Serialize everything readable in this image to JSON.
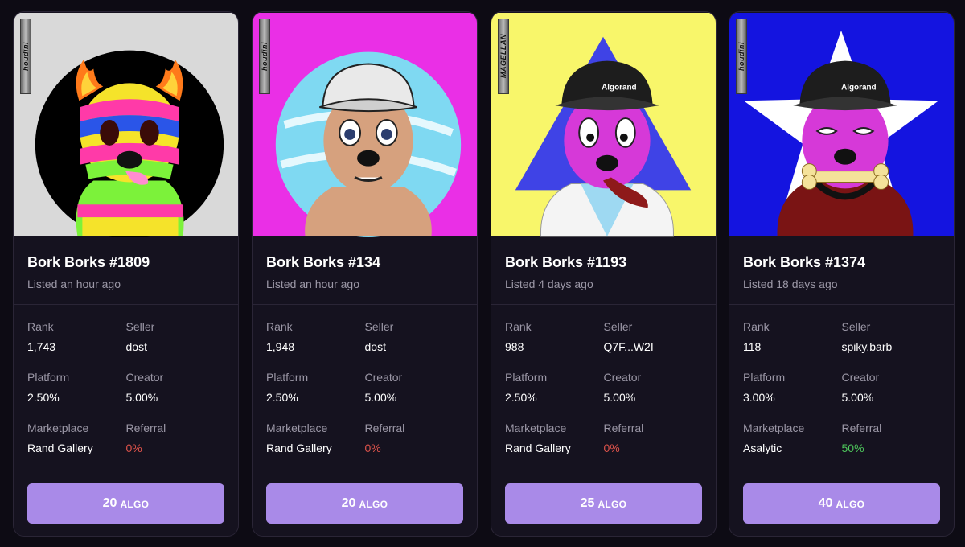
{
  "cards": [
    {
      "title": "Bork Borks #1809",
      "listed": "Listed an hour ago",
      "artist_sig": "houdini",
      "labels": {
        "rank": "Rank",
        "seller": "Seller",
        "platform": "Platform",
        "creator": "Creator",
        "marketplace": "Marketplace",
        "referral": "Referral"
      },
      "rank": "1,743",
      "seller": "dost",
      "platform": "2.50%",
      "creator": "5.00%",
      "marketplace": "Rand Gallery",
      "referral": "0%",
      "price": "20",
      "currency": "ALGO",
      "colors": {
        "background": "#d9d9d9",
        "accent": "#000000"
      }
    },
    {
      "title": "Bork Borks #134",
      "listed": "Listed an hour ago",
      "artist_sig": "houdini",
      "labels": {
        "rank": "Rank",
        "seller": "Seller",
        "platform": "Platform",
        "creator": "Creator",
        "marketplace": "Marketplace",
        "referral": "Referral"
      },
      "rank": "1,948",
      "seller": "dost",
      "platform": "2.50%",
      "creator": "5.00%",
      "marketplace": "Rand Gallery",
      "referral": "0%",
      "price": "20",
      "currency": "ALGO",
      "colors": {
        "background": "#ea2fe6",
        "accent": "#7fd9f2"
      }
    },
    {
      "title": "Bork Borks #1193",
      "listed": "Listed 4 days ago",
      "artist_sig": "MAGELLAN",
      "labels": {
        "rank": "Rank",
        "seller": "Seller",
        "platform": "Platform",
        "creator": "Creator",
        "marketplace": "Marketplace",
        "referral": "Referral"
      },
      "rank": "988",
      "seller": "Q7F...W2I",
      "platform": "2.50%",
      "creator": "5.00%",
      "marketplace": "Rand Gallery",
      "referral": "0%",
      "price": "25",
      "currency": "ALGO",
      "colors": {
        "background": "#f8f66a",
        "accent": "#3f43e6"
      }
    },
    {
      "title": "Bork Borks #1374",
      "listed": "Listed 18 days ago",
      "artist_sig": "houdini",
      "labels": {
        "rank": "Rank",
        "seller": "Seller",
        "platform": "Platform",
        "creator": "Creator",
        "marketplace": "Marketplace",
        "referral": "Referral"
      },
      "rank": "118",
      "seller": "spiky.barb",
      "platform": "3.00%",
      "creator": "5.00%",
      "marketplace": "Asalytic",
      "referral": "50%",
      "price": "40",
      "currency": "ALGO",
      "colors": {
        "background": "#1414e0",
        "accent": "#ffffff"
      }
    }
  ],
  "hat_brand": "Algorand"
}
